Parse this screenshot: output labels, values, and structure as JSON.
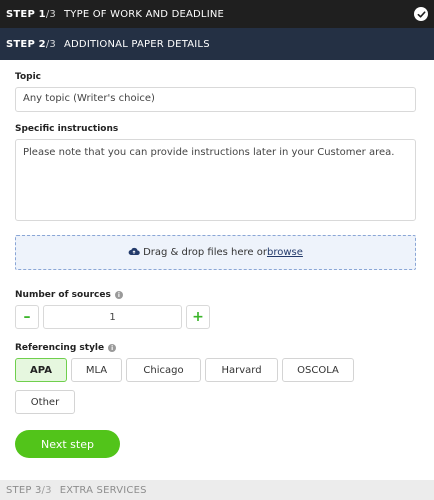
{
  "steps": [
    {
      "current": "1",
      "total": "/3",
      "title": "TYPE OF WORK AND DEADLINE"
    },
    {
      "current": "2",
      "total": "/3",
      "title": "ADDITIONAL PAPER DETAILS"
    },
    {
      "current": "3",
      "total": "/3",
      "title": "EXTRA SERVICES"
    }
  ],
  "step_label": "STEP ",
  "topic": {
    "label": "Topic",
    "value": "Any topic (Writer's choice)"
  },
  "instructions": {
    "label": "Specific instructions",
    "placeholder": "Please note that you can provide instructions later in your Customer area."
  },
  "upload": {
    "text": "Drag & drop files here or ",
    "link": "browse"
  },
  "sources": {
    "label": "Number of sources",
    "value": "1",
    "minus": "–",
    "plus": "+"
  },
  "referencing": {
    "label": "Referencing style",
    "options": [
      "APA",
      "MLA",
      "Chicago",
      "Harvard",
      "OSCOLA",
      "Other"
    ],
    "selected": "APA"
  },
  "next_button": "Next step",
  "colors": {
    "accent": "#52c41a",
    "step_active": "#243044"
  }
}
